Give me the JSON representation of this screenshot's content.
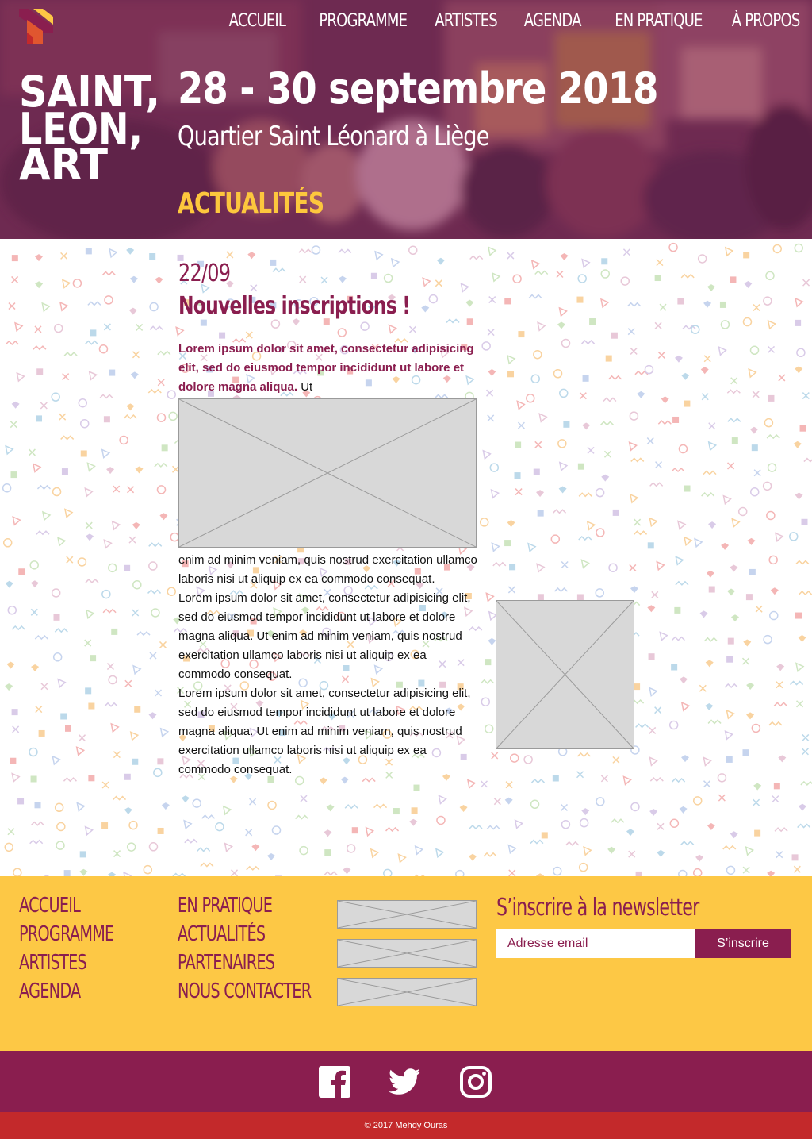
{
  "nav": {
    "items": [
      {
        "label": "ACCUEIL"
      },
      {
        "label": "PROGRAMME"
      },
      {
        "label": "ARTISTES"
      },
      {
        "label": "AGENDA"
      },
      {
        "label": "EN PRATIQUE"
      },
      {
        "label": "À PROPOS"
      }
    ]
  },
  "brand": {
    "wordmark_lines": [
      "SAINT,",
      "LEON,",
      "ART"
    ],
    "primary_color": "#8a1e4f",
    "accent_color": "#fdc845",
    "red_color": "#c3292b"
  },
  "header": {
    "dates": "28 - 30 septembre 2018",
    "place": "Quartier Saint Léonard à Liège",
    "section_title": "ACTUALITÉS"
  },
  "article": {
    "date": "22/09",
    "title": "Nouvelles inscriptions !",
    "lead": "Lorem ipsum dolor sit amet, consectetur adipisicing elit, sed do eiusmod tempor incididunt ut labore et dolore magna aliqua.",
    "lead_tail": " Ut",
    "paragraph_1_cont": "enim ad minim veniam, quis nostrud exercitation ullamco laboris nisi ut aliquip ex ea commodo consequat.",
    "paragraph_2": "Lorem ipsum dolor sit amet, consectetur adipisicing elit, sed do eiusmod tempor incididunt ut labore et dolore magna aliqua. Ut enim ad minim veniam, quis nostrud exercitation ullamco laboris nisi ut aliquip ex ea commodo consequat.",
    "paragraph_3": "Lorem ipsum dolor sit amet, consectetur adipisicing elit, sed do eiusmod tempor incididunt ut labore et dolore magna aliqua. Ut enim ad minim veniam, quis nostrud exercitation ullamco laboris nisi ut aliquip ex ea commodo consequat."
  },
  "footer": {
    "links_col_1": [
      {
        "label": "ACCUEIL"
      },
      {
        "label": "PROGRAMME"
      },
      {
        "label": "ARTISTES"
      },
      {
        "label": "AGENDA"
      }
    ],
    "links_col_2": [
      {
        "label": "EN PRATIQUE"
      },
      {
        "label": "ACTUALITÉS"
      },
      {
        "label": "PARTENAIRES"
      },
      {
        "label": "NOUS CONTACTER"
      }
    ],
    "newsletter": {
      "title": "S’inscrire à la newsletter",
      "placeholder": "Adresse email",
      "button_label": "S’inscrire"
    },
    "social": [
      {
        "icon": "facebook-icon"
      },
      {
        "icon": "twitter-icon"
      },
      {
        "icon": "instagram-icon"
      }
    ],
    "copyright": "© 2017 Mehdy Ouras"
  }
}
